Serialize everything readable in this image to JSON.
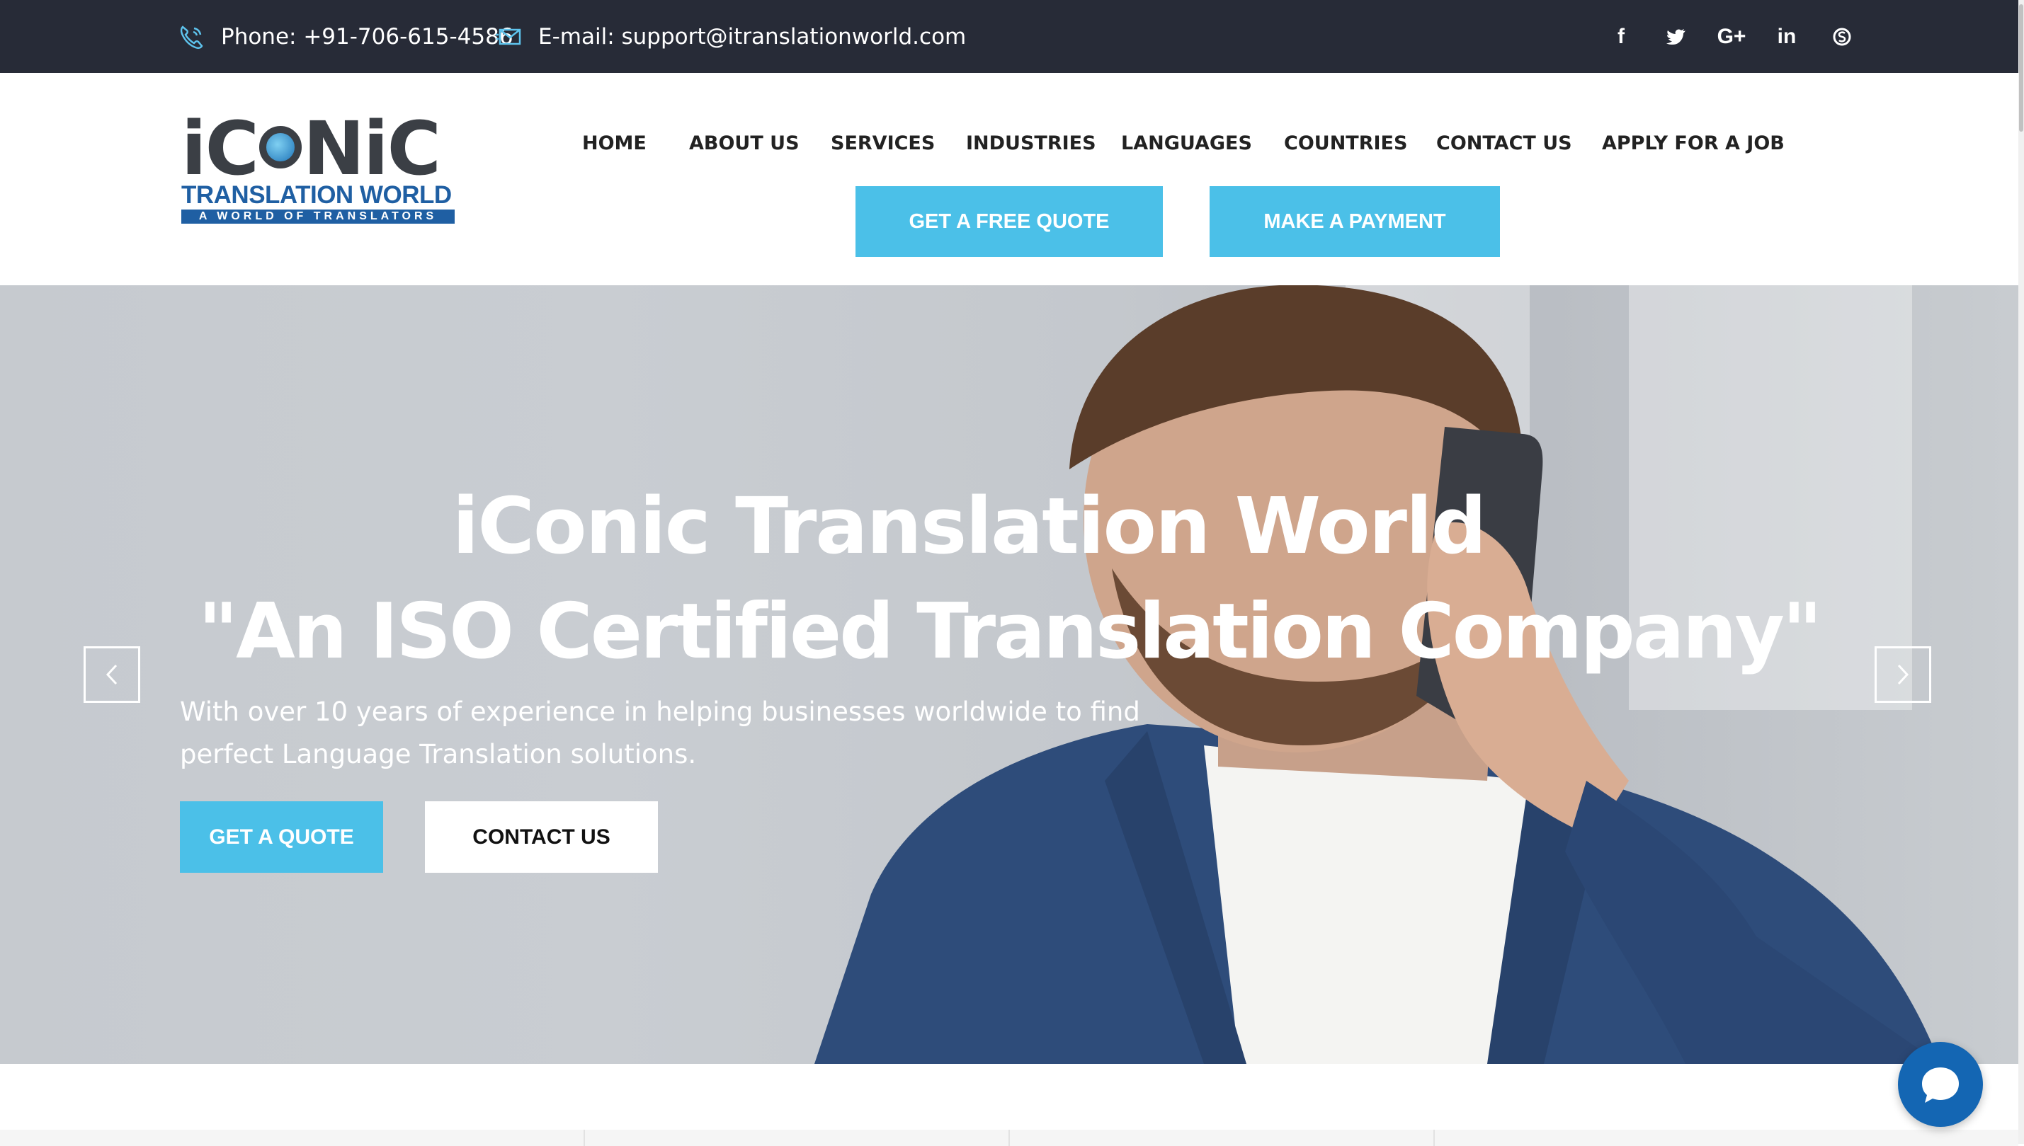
{
  "topbar": {
    "phone": "Phone: +91-706-615-4586",
    "email": "E-mail: support@itranslationworld.com",
    "social": [
      {
        "icon": "facebook-icon",
        "glyph": "f"
      },
      {
        "icon": "twitter-icon",
        "glyph": "🐦"
      },
      {
        "icon": "google-plus-icon",
        "glyph": "G+"
      },
      {
        "icon": "linkedin-icon",
        "glyph": "in"
      },
      {
        "icon": "skype-icon",
        "glyph": "S"
      }
    ]
  },
  "logo": {
    "brand_a": "iC",
    "brand_b": "NiC",
    "line1": "TRANSLATION WORLD",
    "line2": "A WORLD OF TRANSLATORS"
  },
  "nav": {
    "items": [
      "HOME",
      "ABOUT US",
      "SERVICES",
      "INDUSTRIES",
      "LANGUAGES",
      "COUNTRIES",
      "CONTACT US",
      "APPLY FOR A JOB"
    ]
  },
  "header_buttons": {
    "quote": "GET A FREE QUOTE",
    "payment": "MAKE A PAYMENT"
  },
  "hero": {
    "title": "iConic Translation World",
    "subtitle": "\"An ISO Certified Translation Company\"",
    "description": "With over 10 years of experience in helping businesses worldwide to find perfect Language Translation solutions.",
    "cta_primary": "GET A QUOTE",
    "cta_secondary": "CONTACT US"
  },
  "colors": {
    "topbar_bg": "#272b37",
    "accent": "#4bc0e8",
    "chat_bg": "#1466b3",
    "logo_blue": "#1f5fa3"
  }
}
